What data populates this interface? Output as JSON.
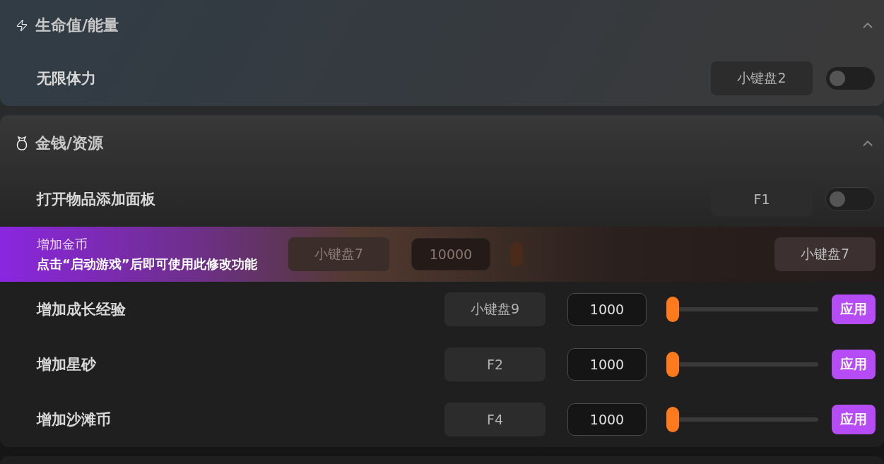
{
  "sections": [
    {
      "title": "生命值/能量",
      "expanded": true,
      "items": [
        {
          "kind": "toggle",
          "label": "无限体力",
          "hotkey": "小键盘2",
          "on": false
        }
      ]
    },
    {
      "title": "金钱/资源",
      "expanded": true,
      "items": [
        {
          "kind": "toggle",
          "label": "打开物品添加面板",
          "hotkey": "F1",
          "on": false
        },
        {
          "kind": "locked",
          "label": "增加金币",
          "hint": "点击“启动游戏”后即可使用此修改功能",
          "hotkey": "小键盘7",
          "value": "10000",
          "action_hotkey": "小键盘7"
        },
        {
          "kind": "slider",
          "label": "增加成长经验",
          "hotkey": "小键盘9",
          "value": "1000",
          "level": 0,
          "button": "应用"
        },
        {
          "kind": "slider",
          "label": "增加星砂",
          "hotkey": "F2",
          "value": "1000",
          "level": 0,
          "button": "应用"
        },
        {
          "kind": "slider",
          "label": "增加沙滩币",
          "hotkey": "F4",
          "value": "1000",
          "level": 0,
          "button": "应用"
        }
      ]
    }
  ]
}
